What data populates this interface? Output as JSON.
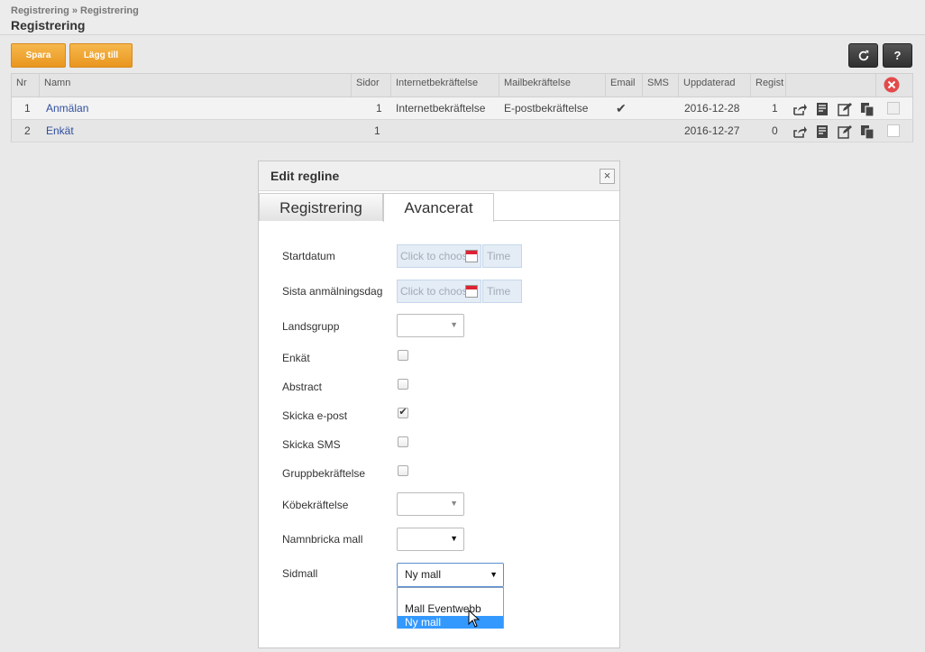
{
  "header": {
    "breadcrumb": "Registrering » Registrering",
    "title": "Registrering"
  },
  "toolbar": {
    "save_label": "Spara",
    "add_label": "Lägg till",
    "refresh_icon": "refresh-icon",
    "help_label": "?"
  },
  "table": {
    "columns": [
      "Nr",
      "Namn",
      "Sidor",
      "Internetbekräftelse",
      "Mailbekräftelse",
      "Email",
      "SMS",
      "Uppdaterad",
      "Regist"
    ],
    "rows": [
      {
        "nr": "1",
        "namn": "Anmälan",
        "sidor": "1",
        "internet": "Internetbekräftelse",
        "mail": "E-postbekräftelse",
        "email": "✔",
        "sms": "",
        "updated": "2016-12-28",
        "regist": "1"
      },
      {
        "nr": "2",
        "namn": "Enkät",
        "sidor": "1",
        "internet": "",
        "mail": "",
        "email": "",
        "sms": "",
        "updated": "2016-12-27",
        "regist": "0"
      }
    ],
    "row_actions": [
      "share-icon",
      "notes-icon",
      "edit-icon",
      "copy-icon"
    ],
    "delete_icon": "delete-all-icon"
  },
  "dialog": {
    "title": "Edit regline",
    "close": "×",
    "tabs": [
      "Registrering",
      "Avancerat"
    ],
    "active_tab": "Avancerat",
    "fields": {
      "startdatum": "Startdatum",
      "sista": "Sista anmälningsdag",
      "landsgrupp": "Landsgrupp",
      "enkat": "Enkät",
      "abstract": "Abstract",
      "skicka_epost": "Skicka e-post",
      "skicka_sms": "Skicka SMS",
      "grupp": "Gruppbekräftelse",
      "kobek": "Köbekräftelse",
      "namnbricka": "Namnbricka mall",
      "sidmall": "Sidmall"
    },
    "date_placeholder": "Click to choose",
    "time_placeholder": "Time",
    "checkboxes": {
      "enkat": false,
      "abstract": false,
      "skicka_epost": true,
      "skicka_sms": false,
      "grupp": false
    },
    "check_mark": "✔",
    "sidmall_value": "Ny mall",
    "sidmall_options": [
      "",
      "Mall Eventwebb",
      "Ny mall"
    ],
    "sidmall_highlighted": "Ny mall"
  }
}
